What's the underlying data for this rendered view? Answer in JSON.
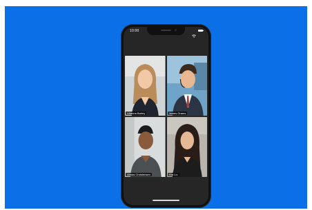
{
  "status_bar": {
    "time": "10:00"
  },
  "participants": [
    {
      "name": "Lilianna Bahny"
    },
    {
      "name": "James Grams"
    },
    {
      "name": "Abbas Christensen"
    },
    {
      "name": "Ella Liu"
    }
  ],
  "icons": {
    "wifi": "wifi-icon",
    "battery": "battery-icon"
  },
  "colors": {
    "background": "#0b6fe8",
    "phone_body": "#101010",
    "active_speaker_border": "#53b34b"
  }
}
